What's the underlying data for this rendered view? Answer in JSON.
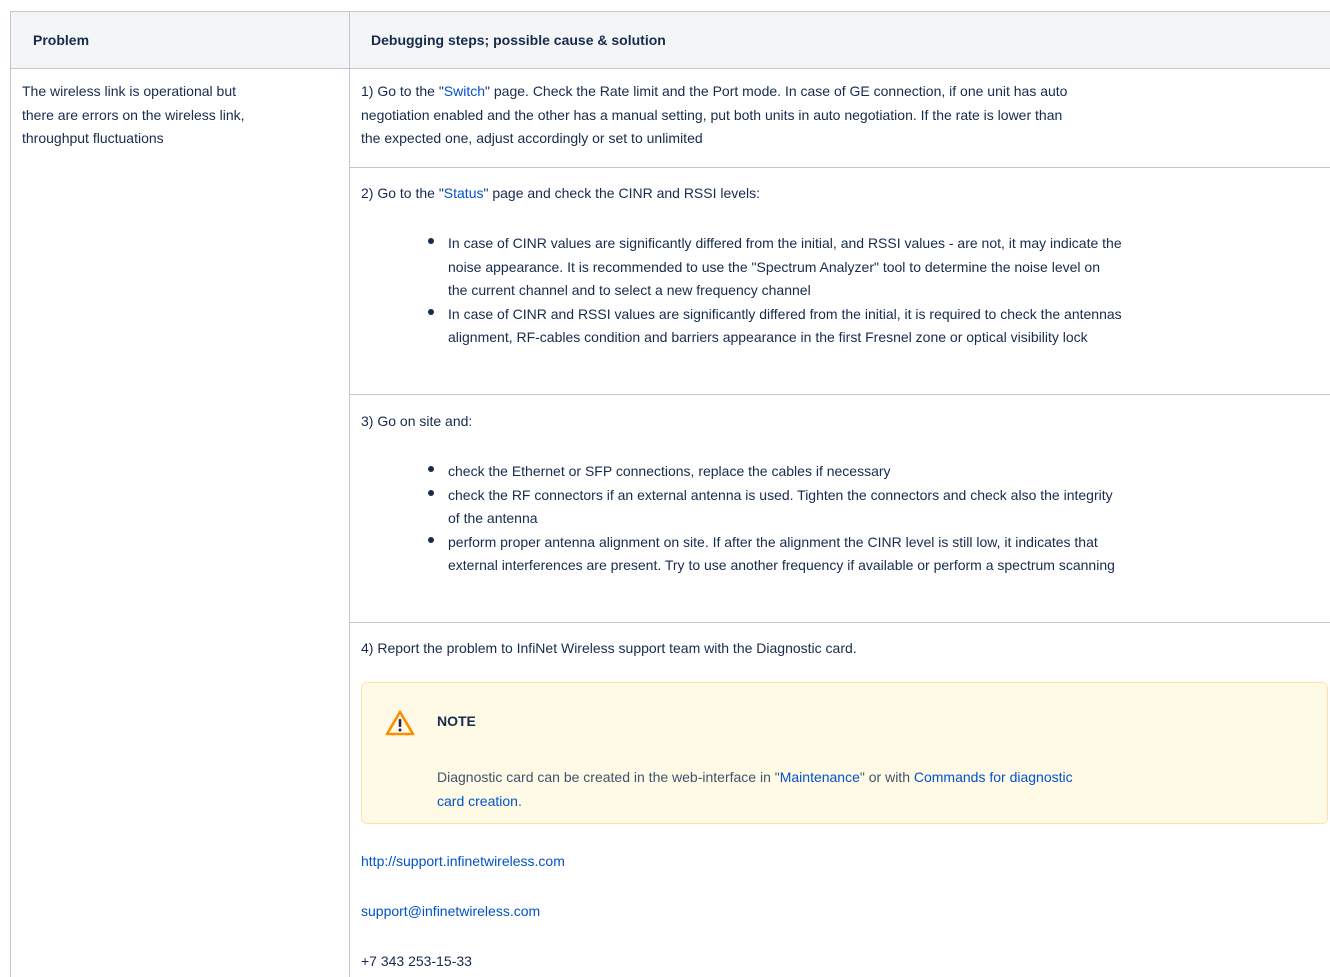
{
  "header": {
    "col1": "Problem",
    "col2": "Debugging steps; possible cause & solution"
  },
  "problem": {
    "line1": "The wireless link is operational but",
    "line2": "there are errors on the wireless link,",
    "line3": "throughput fluctuations"
  },
  "step1": {
    "prefix": "1) Go to the \"",
    "link": "Switch",
    "suffix": "\" page. Check the Rate limit and the Port mode. In case of GE connection, if one unit has auto",
    "line2": "negotiation enabled and the other has a manual setting, put both units in auto negotiation.  If the rate is lower than",
    "line3": "the expected one, adjust accordingly or set to unlimited"
  },
  "step2": {
    "prefix": "2) Go to the \"",
    "link": "Status",
    "suffix": "\" page and check the CINR and RSSI levels:",
    "bullets": [
      {
        "l1": "In case of CINR values are significantly differed from the initial, and RSSI values - are not, it may indicate the",
        "l2": "noise appearance. It is recommended to use the \"Spectrum Analyzer\" tool to determine the noise level on",
        "l3": "the current channel and to select a new frequency channel"
      },
      {
        "l1": "In case of CINR and RSSI values are significantly differed from the initial, it is required to check the antennas",
        "l2": "alignment, RF-cables condition and barriers appearance in the first Fresnel zone or optical visibility lock"
      }
    ]
  },
  "step3": {
    "intro": "3) Go on site and:",
    "bullets": [
      {
        "l1": "check the Ethernet or SFP connections, replace the cables if necessary"
      },
      {
        "l1": "check the RF connectors if an external antenna is used. Tighten the connectors and check also the integrity",
        "l2": "of the antenna"
      },
      {
        "l1": "perform proper antenna alignment on site. If after the alignment the CINR level is still low, it indicates that",
        "l2": "external interferences are present. Try to use another frequency if available or perform a spectrum scanning"
      }
    ]
  },
  "step4": {
    "intro": "4) Report the problem to InfiNet Wireless support team with the Diagnostic card.",
    "note_title": "NOTE",
    "note_prefix": "Diagnostic card can be created in the web-interface in \"",
    "note_link1": "Maintenance",
    "note_mid": "\" or with ",
    "note_link2": "Commands for diagnostic",
    "note_link2b": "card creation",
    "note_suffix": ".",
    "url": "http://support.infinetwireless.com",
    "email": "support@infinetwireless.com",
    "phone": "+7 343 253-15-33"
  },
  "icons": {
    "note_icon": "warning-icon",
    "warning_color": "#ff8b00"
  }
}
